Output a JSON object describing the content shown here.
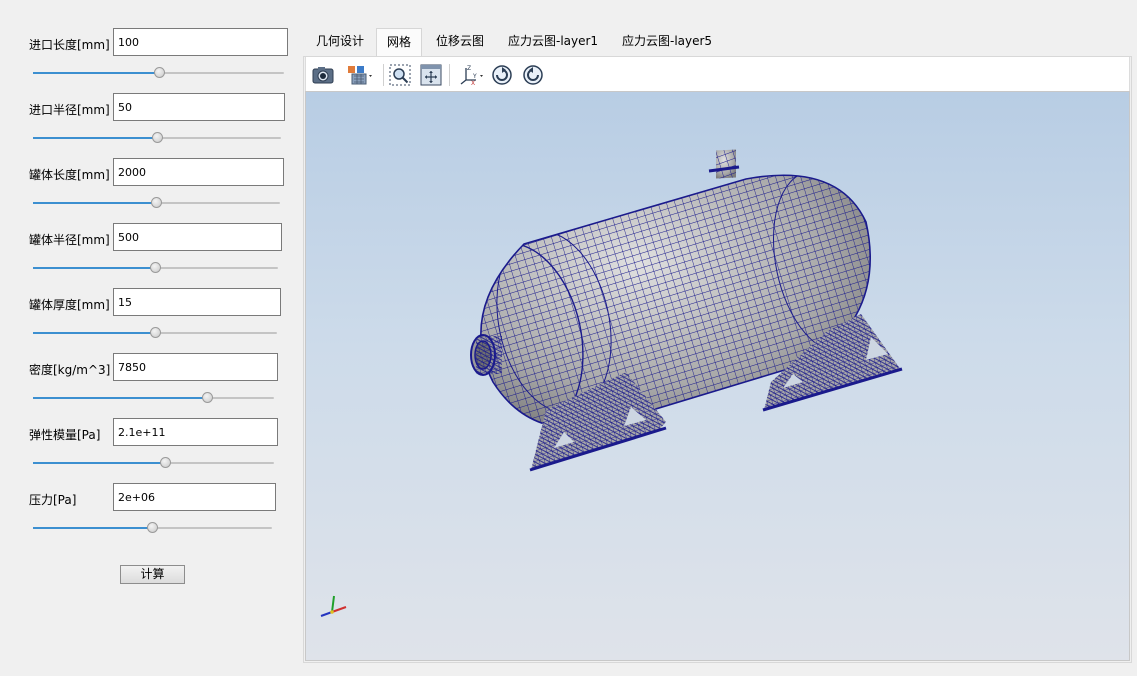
{
  "params": [
    {
      "label": "进口长度[mm]",
      "value": "100"
    },
    {
      "label": "进口半径[mm]",
      "value": "50"
    },
    {
      "label": "罐体长度[mm]",
      "value": "2000"
    },
    {
      "label": "罐体半径[mm]",
      "value": "500"
    },
    {
      "label": "罐体厚度[mm]",
      "value": "15"
    },
    {
      "label": "密度[kg/m^3]",
      "value": "7850"
    },
    {
      "label": "弹性模量[Pa]",
      "value": "2.1e+11"
    },
    {
      "label": "压力[Pa]",
      "value": "2e+06"
    }
  ],
  "slider_levels_percent": [
    51,
    50,
    49,
    49,
    50,
    73,
    55,
    50
  ],
  "calc_button": "计算",
  "tabs": [
    "几何设计",
    "网格",
    "位移云图",
    "应力云图-layer1",
    "应力云图-layer5"
  ],
  "active_tab_index": 1,
  "toolbar_icons": [
    "camera-icon",
    "display-mode-icon",
    "zoom-box-icon",
    "fit-view-icon",
    "axes-view-icon",
    "rotate-cw-icon",
    "rotate-ccw-icon"
  ],
  "axis_labels": {
    "z": "Z",
    "y": "Y",
    "x": "X"
  },
  "colors": {
    "mesh": "#1a1a8c",
    "slider_fill": "#3c8fd0",
    "viewport_top": "#b8cde4",
    "viewport_bottom": "#dfe3ea"
  }
}
